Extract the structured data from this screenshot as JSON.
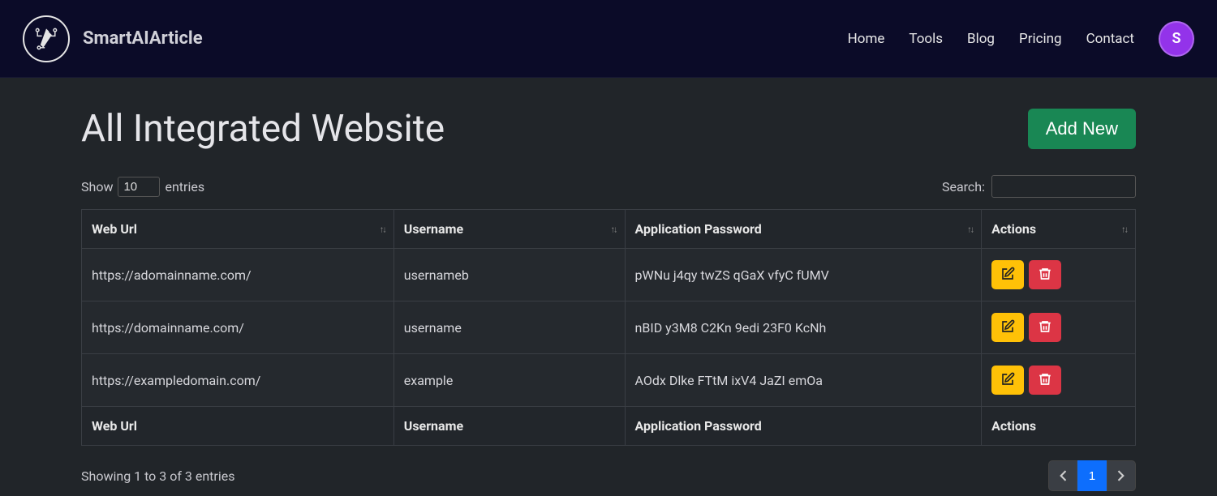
{
  "brand": {
    "name": "SmartAIArticle"
  },
  "nav": {
    "items": [
      {
        "label": "Home"
      },
      {
        "label": "Tools"
      },
      {
        "label": "Blog"
      },
      {
        "label": "Pricing"
      },
      {
        "label": "Contact"
      }
    ],
    "avatar_initial": "S"
  },
  "page": {
    "title": "All Integrated Website",
    "add_label": "Add New"
  },
  "table": {
    "show_label_pre": "Show",
    "show_value": "10",
    "show_label_post": "entries",
    "search_label": "Search:",
    "search_value": "",
    "headers": {
      "url": "Web Url",
      "username": "Username",
      "password": "Application Password",
      "actions": "Actions"
    },
    "rows": [
      {
        "url": "https://adomainname.com/",
        "username": "usernameb",
        "password": "pWNu j4qy twZS qGaX vfyC fUMV"
      },
      {
        "url": "https://domainname.com/",
        "username": "username",
        "password": "nBID y3M8 C2Kn 9edi 23F0 KcNh"
      },
      {
        "url": "https://exampledomain.com/",
        "username": "example",
        "password": "AOdx Dlke FTtM ixV4 JaZI emOa"
      }
    ],
    "info": "Showing 1 to 3 of 3 entries",
    "pagination": {
      "current": "1"
    }
  }
}
